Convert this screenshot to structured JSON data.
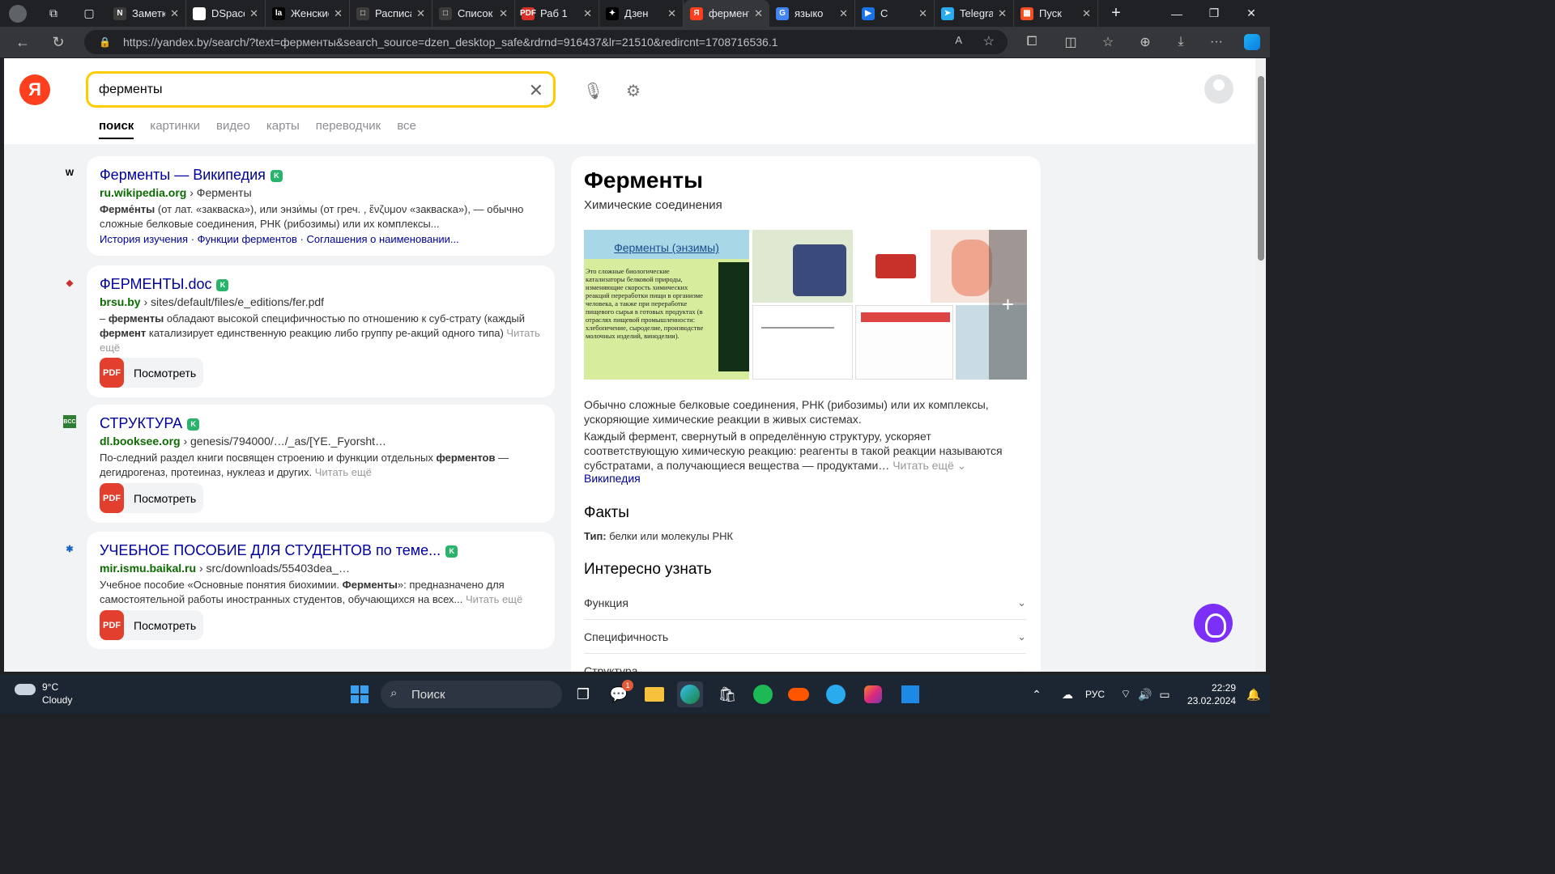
{
  "browser": {
    "tabs": [
      {
        "title": "Заметки",
        "fav": "N",
        "color": "#3c3c3c"
      },
      {
        "title": "DSpace",
        "fav": "D",
        "color": "#ffffff"
      },
      {
        "title": "Женские",
        "fav": "la",
        "color": "#000000"
      },
      {
        "title": "Расписание",
        "fav": "□",
        "color": "#3c3c3c"
      },
      {
        "title": "Список",
        "fav": "□",
        "color": "#3c3c3c"
      },
      {
        "title": "Раб 1",
        "fav": "PDF",
        "color": "#d93025"
      },
      {
        "title": "Дзен",
        "fav": "✦",
        "color": "#000000"
      },
      {
        "title": "ферменты",
        "fav": "Я",
        "color": "#fc3f1d",
        "active": true
      },
      {
        "title": "языко",
        "fav": "G",
        "color": "#4285f4"
      },
      {
        "title": "C",
        "fav": "▶",
        "color": "#1a73e8"
      },
      {
        "title": "Telegram",
        "fav": "➤",
        "color": "#2aabee"
      },
      {
        "title": "Пуск",
        "fav": "▦",
        "color": "#f25022"
      }
    ],
    "url": "https://yandex.by/search/?text=ферменты&search_source=dzen_desktop_safe&rdrnd=916437&lr=21510&redircnt=1708716536.1"
  },
  "header": {
    "logo": "Я",
    "query": "ферменты",
    "tabs": [
      "поиск",
      "картинки",
      "видео",
      "карты",
      "переводчик",
      "все"
    ]
  },
  "results": [
    {
      "icon": "W",
      "title_b": "Ферменты",
      "title_rest": " — Википедия",
      "domain": "ru.wikipedia.org",
      "path": " › Ферменты",
      "snippet_html": "<b>Ферме́нты</b> (от лат. «закваска»), или энзи́мы (от греч. , ἔνζυμον «закваска»), — обычно сложные белковые соединения, РНК (рибозимы) или их комплексы...",
      "links": "История изучения  ·  Функции ферментов  ·  Соглашения о наименовании..."
    },
    {
      "icon": "◆",
      "title_b": "ФЕРМЕНТЫ",
      "title_rest": ".doc",
      "domain": "brsu.by",
      "path": " › sites/default/files/e_editions/fer.pdf",
      "snippet_html": "– <b>ферменты</b> обладают высокой специфичностью по отношению к суб-страту (каждый <b>фермент</b> катализирует единственную реакцию либо группу ре-акций одного типа)",
      "more": "Читать ещё",
      "pdf": "Посмотреть"
    },
    {
      "icon": "BCC",
      "title_b": "СТРУКТУРА",
      "title_rest": "",
      "domain": "dl.booksee.org",
      "path": " › genesis/794000/…/_as/[YE._Fyorsht…",
      "snippet_html": "По-следний раздел книги посвящен строению и функции отдельных <b>ферментов</b> — дегидрогеназ, протеиназ, нуклеаз и других.",
      "more": "Читать ещё",
      "pdf": "Посмотреть"
    },
    {
      "icon": "✱",
      "title_b": "УЧЕБНОЕ ПОСОБИЕ ДЛЯ СТУДЕНТОВ",
      "title_rest": " по теме...",
      "domain": "mir.ismu.baikal.ru",
      "path": " › src/downloads/55403dea_…",
      "snippet_html": "Учебное пособие «Основные понятия биохимии. <b>Ферменты</b>»: предназначено для самостоятельной работы иностранных студентов, обучающихся на всех...",
      "more": "Читать ещё",
      "pdf": "Посмотреть"
    }
  ],
  "pdf_label": "PDF",
  "badge_letter": "K",
  "knowledge": {
    "title": "Ферменты",
    "subtitle": "Химические соединения",
    "img_main_header": "Ферменты (энзимы)",
    "img_main_text": "Это сложные биологические катализаторы белковой природы, изменяющие скорость химических реакций переработки пищи в организме человека, а также при переработке пищевого сырья в готовых продуктах (в отраслях пищевой промышленности: хлебопечение, сыроделие, производстве молочных изделий, виноделии).",
    "img_plus": "+",
    "desc1": "Обычно сложные белковые соединения, РНК (рибозимы) или их комплексы, ускоряющие химические реакции в живых системах.",
    "desc2": "Каждый фермент, свернутый в определённую структуру, ускоряет соответствующую химическую реакцию: реагенты в такой реакции называются субстратами, а получающиеся вещества — продуктами…",
    "desc2_more": "Читать ещё ⌄",
    "source": "Википедия",
    "facts_title": "Факты",
    "fact_label": "Тип:",
    "fact_value": " белки или молекулы РНК",
    "interesting_title": "Интересно узнать",
    "items": [
      "Функция",
      "Специфичность",
      "Структура"
    ]
  },
  "taskbar": {
    "temp": "9°C",
    "weather": "Cloudy",
    "search": "Поиск",
    "lang": "РУС",
    "time": "22:29",
    "date": "23.02.2024",
    "notif": "1"
  }
}
